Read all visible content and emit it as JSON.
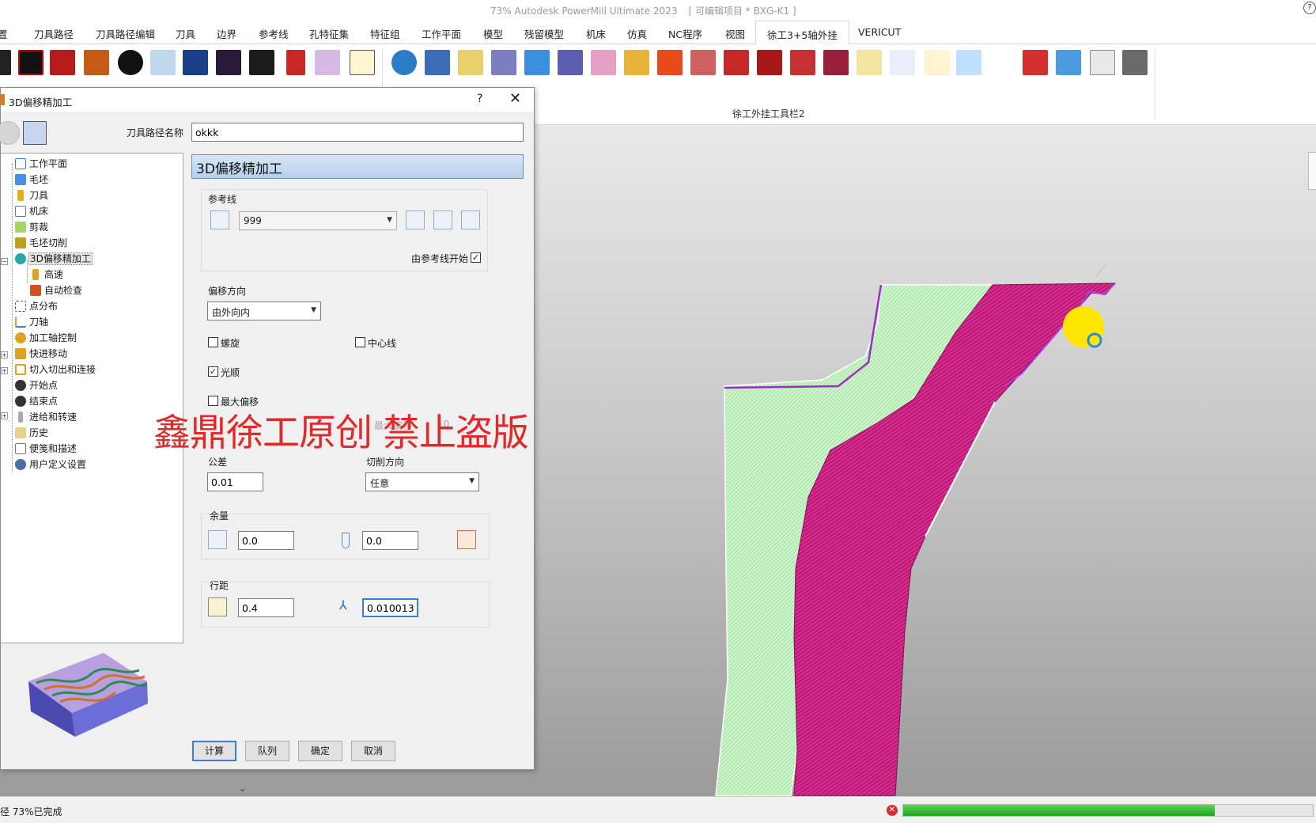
{
  "app": {
    "title": "73% Autodesk PowerMill Ultimate 2023",
    "project": "[ 可编辑项目 * BXG-K1 ]",
    "help": "?"
  },
  "tabs": [
    "置",
    "刀具路径",
    "刀具路径编辑",
    "刀具",
    "边界",
    "参考线",
    "孔特征集",
    "特征组",
    "工作平面",
    "模型",
    "残留模型",
    "机床",
    "仿真",
    "NC程序",
    "视图",
    "徐工3+5轴外挂",
    "VERICUT"
  ],
  "active_tab": "徐工3+5轴外挂",
  "ribbon": {
    "group_label": "徐工外挂工具栏2"
  },
  "dialog": {
    "title": "3D偏移精加工",
    "help": "?",
    "close": "✕",
    "path_name_label": "刀具路径名称",
    "path_name_value": "okkk",
    "header": "3D偏移精加工",
    "tree": [
      {
        "label": "工作平面",
        "icon": "workplane-icon",
        "color": "#3a7bd5"
      },
      {
        "label": "毛坯",
        "icon": "block-icon",
        "color": "#4a90e2"
      },
      {
        "label": "刀具",
        "icon": "tool-icon",
        "color": "#e0b020"
      },
      {
        "label": "机床",
        "icon": "machine-icon",
        "color": "#607d8b"
      },
      {
        "label": "剪裁",
        "icon": "trim-icon",
        "color": "#7cb342"
      },
      {
        "label": "毛坯切削",
        "icon": "stock-cut-icon",
        "color": "#c0a020"
      },
      {
        "label": "3D偏移精加工",
        "icon": "offset-finish-icon",
        "color": "#2aa7a7"
      },
      {
        "label": "高速",
        "icon": "high-speed-icon",
        "color": "#e0a020"
      },
      {
        "label": "自动检查",
        "icon": "auto-check-icon",
        "color": "#d05020"
      },
      {
        "label": "点分布",
        "icon": "point-dist-icon",
        "color": "#555"
      },
      {
        "label": "刀轴",
        "icon": "tool-axis-icon",
        "color": "#e0a020"
      },
      {
        "label": "加工轴控制",
        "icon": "axis-control-icon",
        "color": "#e0a020"
      },
      {
        "label": "快进移动",
        "icon": "rapid-move-icon",
        "color": "#e0a020"
      },
      {
        "label": "切入切出和连接",
        "icon": "lead-link-icon",
        "color": "#e0a020"
      },
      {
        "label": "开始点",
        "icon": "start-point-icon",
        "color": "#333"
      },
      {
        "label": "结束点",
        "icon": "end-point-icon",
        "color": "#333"
      },
      {
        "label": "进给和转速",
        "icon": "feed-speed-icon",
        "color": "#999"
      },
      {
        "label": "历史",
        "icon": "history-icon",
        "color": "#c0a040"
      },
      {
        "label": "便笺和描述",
        "icon": "notes-icon",
        "color": "#777"
      },
      {
        "label": "用户定义设置",
        "icon": "user-settings-icon",
        "color": "#4a6fa5"
      }
    ],
    "reference": {
      "label": "参考线",
      "value": "999",
      "start_from_ref": "由参考线开始"
    },
    "offset_direction": {
      "label": "偏移方向",
      "value": "由外向内"
    },
    "spiral_label": "螺旋",
    "centerline_label": "中心线",
    "smooth_label": "光顺",
    "max_offset_label": "最大偏移",
    "max_offset_hidden": "最大偏移",
    "max_offset_value": "10",
    "tolerance": {
      "label": "公差",
      "value": "0.01"
    },
    "cut_direction": {
      "label": "切削方向",
      "value": "任意"
    },
    "allowance": {
      "label": "余量",
      "radial": "0.0",
      "axial": "0.0"
    },
    "stepover": {
      "label": "行距",
      "value": "0.4",
      "stepdown": "0.010013"
    },
    "buttons": {
      "calculate": "计算",
      "queue": "队列",
      "ok": "确定",
      "cancel": "取消"
    }
  },
  "watermark": "鑫鼎徐工原创 禁止盗版",
  "status": {
    "text": "径  73%已完成",
    "progress": 0.76
  },
  "colors": {
    "toolpath_magenta": "#c2187a",
    "toolpath_green": "#c8f5c8",
    "tool_yellow": "#ffe600",
    "progress_green": "#22aa22"
  }
}
